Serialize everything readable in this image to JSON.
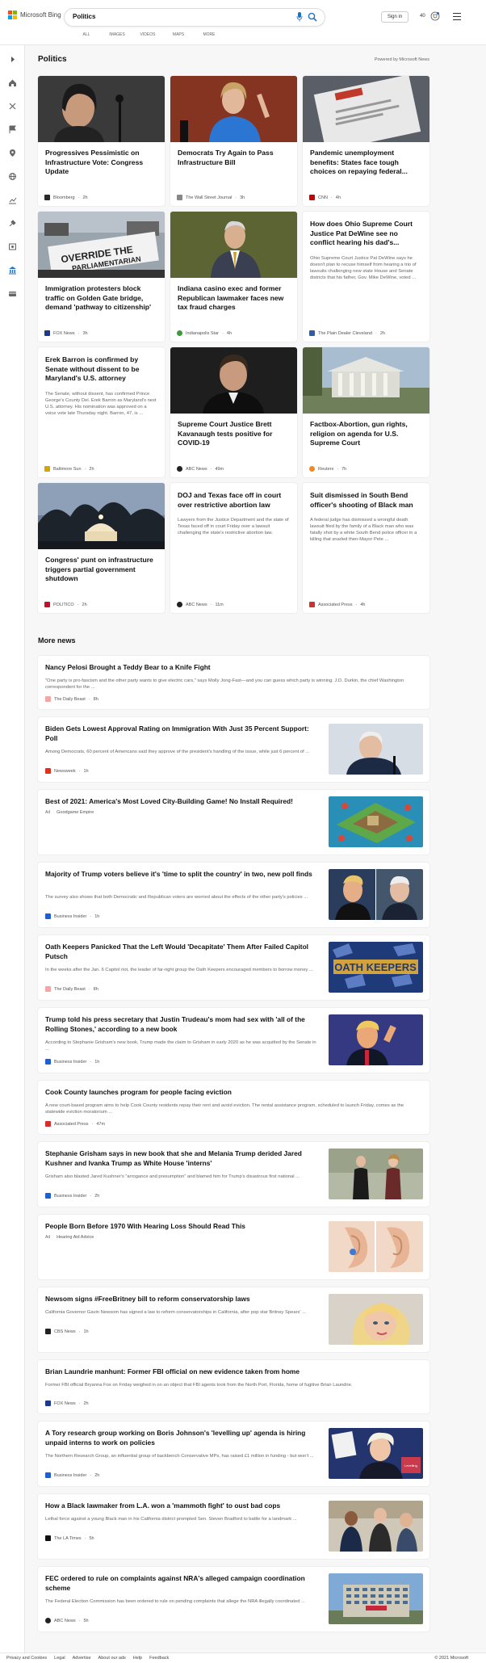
{
  "header": {
    "brand": "Microsoft Bing",
    "search_value": "Politics",
    "signin_label": "Sign in",
    "rewards_count": "40",
    "scopes": [
      "ALL",
      "IMAGES",
      "VIDEOS",
      "MAPS",
      "MORE"
    ]
  },
  "section": {
    "title": "Politics",
    "powered_by": "Powered by Microsoft News"
  },
  "cards": [
    {
      "title": "Progressives Pessimistic on Infrastructure Vote: Congress Update",
      "text": "",
      "source": "Bloomberg",
      "age": "2h",
      "logo_color": "#2a2a2a"
    },
    {
      "title": "Democrats Try Again to Pass Infrastructure Bill",
      "text": "",
      "source": "The Wall Street Journal",
      "age": "3h",
      "logo_color": "#888888"
    },
    {
      "title": "Pandemic unemployment benefits: States face tough choices on repaying federal...",
      "text": "",
      "source": "CNN",
      "age": "4h",
      "logo_color": "#cc0000"
    },
    {
      "title": "Immigration protesters block traffic on Golden Gate bridge, demand 'pathway to citizenship'",
      "text": "",
      "source": "FOX News",
      "age": "3h",
      "logo_color": "#1b3a8a"
    },
    {
      "title": "Indiana casino exec and former Republican lawmaker faces new tax fraud charges",
      "text": "",
      "source": "Indianapolis Star",
      "age": "4h",
      "logo_color": "#3b9a3b"
    },
    {
      "title": "How does Ohio Supreme Court Justice Pat DeWine see no conflict hearing his dad's...",
      "text": "Ohio Supreme Court Justice Pat DeWine says he doesn't plan to recuse himself from hearing a trio of lawsuits challenging new state House and Senate districts that his father, Gov. Mike DeWine, voted ...",
      "source": "The Plain Dealer Cleveland",
      "age": "2h",
      "logo_color": "#2c5fa8"
    },
    {
      "title": "Erek Barron is confirmed by Senate without dissent to be Maryland's U.S. attorney",
      "text": "The Senate, without dissent, has confirmed Prince George's County Del. Erek Barron as Maryland's next U.S. attorney. His nomination was approved on a voice vote late Thursday night. Barron, 47, is ...",
      "source": "Baltimore Sun",
      "age": "2h",
      "logo_color": "#d9a300"
    },
    {
      "title": "Supreme Court Justice Brett Kavanaugh tests positive for COVID-19",
      "text": "",
      "source": "ABC News",
      "age": "49m",
      "logo_color": "#222222"
    },
    {
      "title": "Factbox-Abortion, gun rights, religion on agenda for U.S. Supreme Court",
      "text": "",
      "source": "Reuters",
      "age": "7h",
      "logo_color": "#f08a24"
    },
    {
      "title": "Congress' punt on infrastructure triggers partial government shutdown",
      "text": "",
      "source": "POLITICO",
      "age": "2h",
      "logo_color": "#c8102e"
    },
    {
      "title": "DOJ and Texas face off in court over restrictive abortion law",
      "text": "Lawyers from the Justice Department and the state of Texas faced off in court Friday over a lawsuit challenging the state's restrictive abortion law.",
      "source": "ABC News",
      "age": "11m",
      "logo_color": "#222222"
    },
    {
      "title": "Suit dismissed in South Bend officer's shooting of Black man",
      "text": "A federal judge has dismissed a wrongful death lawsuit filed by the family of a Black man who was fatally shot by a white South Bend police officer in a killing that snarled then-Mayor Pete ...",
      "source": "Associated Press",
      "age": "4h",
      "logo_color": "#d32f2f"
    }
  ],
  "more_news": {
    "title": "More news",
    "items": [
      {
        "title": "Nancy Pelosi Brought a Teddy Bear to a Knife Fight",
        "text": "\"One party is pro-fascism and the other party wants to give electric cars,\" says Molly Jong-Fast—and you can guess which party is winning. J.D. Durkin, the chief Washington correspondent for the ...",
        "source": "The Daily Beast",
        "age": "8h",
        "ad": "",
        "logo_color": "#f4a6a6"
      },
      {
        "title": "Biden Gets Lowest Approval Rating on Immigration With Just 35 Percent Support: Poll",
        "text": "Among Democrats, 60 percent of Americans said they approve of the president's handling of the issue, while just 6 percent of ...",
        "source": "Newsweek",
        "age": "1h",
        "ad": "",
        "logo_color": "#e0301e"
      },
      {
        "title": "Best of 2021: America's Most Loved City-Building Game! No Install Required!",
        "text": "",
        "source": "Goodgame Empire",
        "age": "",
        "ad": "Ad",
        "logo_color": ""
      },
      {
        "title": "Majority of Trump voters believe it's 'time to split the country' in two, new poll finds",
        "text": "The survey also shows that both Democratic and Republican voters are worried about the effects of the other party's policies ...",
        "source": "Business Insider",
        "age": "1h",
        "ad": "",
        "logo_color": "#1f5fd6"
      },
      {
        "title": "Oath Keepers Panicked That the Left Would 'Decapitate' Them After Failed Capitol Putsch",
        "text": "In the weeks after the Jan. 6 Capitol riot, the leader of far-right group the Oath Keepers encouraged members to borrow money ...",
        "source": "The Daily Beast",
        "age": "8h",
        "ad": "",
        "logo_color": "#f4a6a6"
      },
      {
        "title": "Trump told his press secretary that Justin Trudeau's mom had sex with 'all of the Rolling Stones,' according to a new book",
        "text": "According to Stephanie Grisham's new book, Trump made the claim to Grisham in early 2020 as he was acquitted by the Senate in ...",
        "source": "Business Insider",
        "age": "1h",
        "ad": "",
        "logo_color": "#1f5fd6"
      },
      {
        "title": "Cook County launches program for people facing eviction",
        "text": "A new court-based program aims to help Cook County residents repay their rent and avoid eviction. The rental assistance program, scheduled to launch Friday, comes as the statewide eviction moratorium ...",
        "source": "Associated Press",
        "age": "47m",
        "ad": "",
        "logo_color": "#d32f2f"
      },
      {
        "title": "Stephanie Grisham says in new book that she and Melania Trump derided Jared Kushner and Ivanka Trump as White House 'interns'",
        "text": "Grisham also blasted Jared Kushner's \"arrogance and presumption\" and blamed him for Trump's disastrous first national ...",
        "source": "Business Insider",
        "age": "2h",
        "ad": "",
        "logo_color": "#1f5fd6"
      },
      {
        "title": "People Born Before 1970 With Hearing Loss Should Read This",
        "text": "",
        "source": "Hearing Aid Advice",
        "age": "",
        "ad": "Ad",
        "logo_color": ""
      },
      {
        "title": "Newsom signs #FreeBritney bill to reform conservatorship laws",
        "text": "California Governor Gavin Newsom has signed a law to reform conservatorships in California, after pop star Britney Spears' ...",
        "source": "CBS News",
        "age": "1h",
        "ad": "",
        "logo_color": "#222222"
      },
      {
        "title": "Brian Laundrie manhunt: Former FBI official on new evidence taken from home",
        "text": "Former FBI official Bryanna Fox on Friday weighed in on an object that FBI agents took from the North Port, Florida, home of fugitive Brian Laundrie.",
        "source": "FOX News",
        "age": "2h",
        "ad": "",
        "logo_color": "#1b3a8a"
      },
      {
        "title": "A Tory research group working on Boris Johnson's 'levelling up' agenda is hiring unpaid interns to work on policies",
        "text": "The Northern Research Group, an influential group of backbench Conservative MPs, has raised £1 million in funding - but won't ...",
        "source": "Business Insider",
        "age": "2h",
        "ad": "",
        "logo_color": "#1f5fd6"
      },
      {
        "title": "How a Black lawmaker from L.A. won a 'mammoth fight' to oust bad cops",
        "text": "Lethal force against a young Black man in his California district prompted Sen. Steven Bradford to battle for a landmark ...",
        "source": "The LA Times",
        "age": "5h",
        "ad": "",
        "logo_color": "#111111"
      },
      {
        "title": "FEC ordered to rule on complaints against NRA's alleged campaign coordination scheme",
        "text": "The Federal Election Commission has been ordered to rule on pending complaints that allege the NRA illegally coordinated ...",
        "source": "ABC News",
        "age": "5h",
        "ad": "",
        "logo_color": "#222222"
      }
    ]
  },
  "footer": {
    "links": [
      "Privacy and Cookies",
      "Legal",
      "Advertise",
      "About our ads",
      "Help",
      "Feedback"
    ],
    "copyright": "© 2021 Microsoft"
  }
}
